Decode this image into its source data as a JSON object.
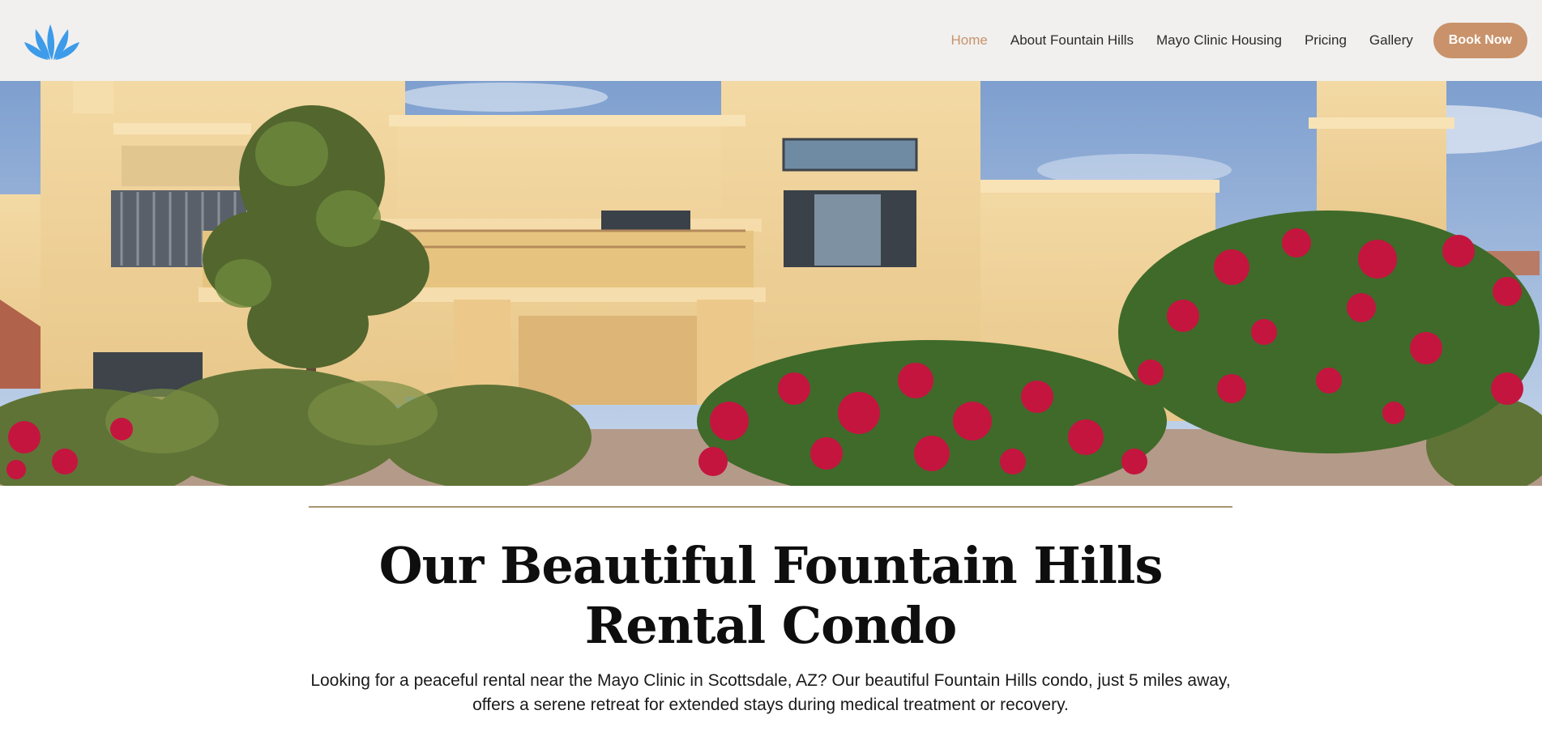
{
  "header": {
    "logo_icon": "fountain-splash-icon",
    "nav": [
      {
        "label": "Home",
        "active": true
      },
      {
        "label": "About Fountain Hills",
        "active": false
      },
      {
        "label": "Mayo Clinic Housing",
        "active": false
      },
      {
        "label": "Pricing",
        "active": false
      },
      {
        "label": "Gallery",
        "active": false
      }
    ],
    "cta_label": "Book Now"
  },
  "colors": {
    "accent": "#c9926a",
    "logo": "#3d9be9",
    "header_bg": "#f1f0ef",
    "divider": "#a89470"
  },
  "hero": {
    "icon": "condo-photo"
  },
  "content": {
    "title": "Our Beautiful Fountain Hills Rental Condo",
    "description": "Looking for a peaceful rental near the Mayo Clinic in Scottsdale, AZ? Our beautiful Fountain Hills condo, just 5 miles away, offers a serene retreat for extended stays during medical treatment or recovery."
  }
}
